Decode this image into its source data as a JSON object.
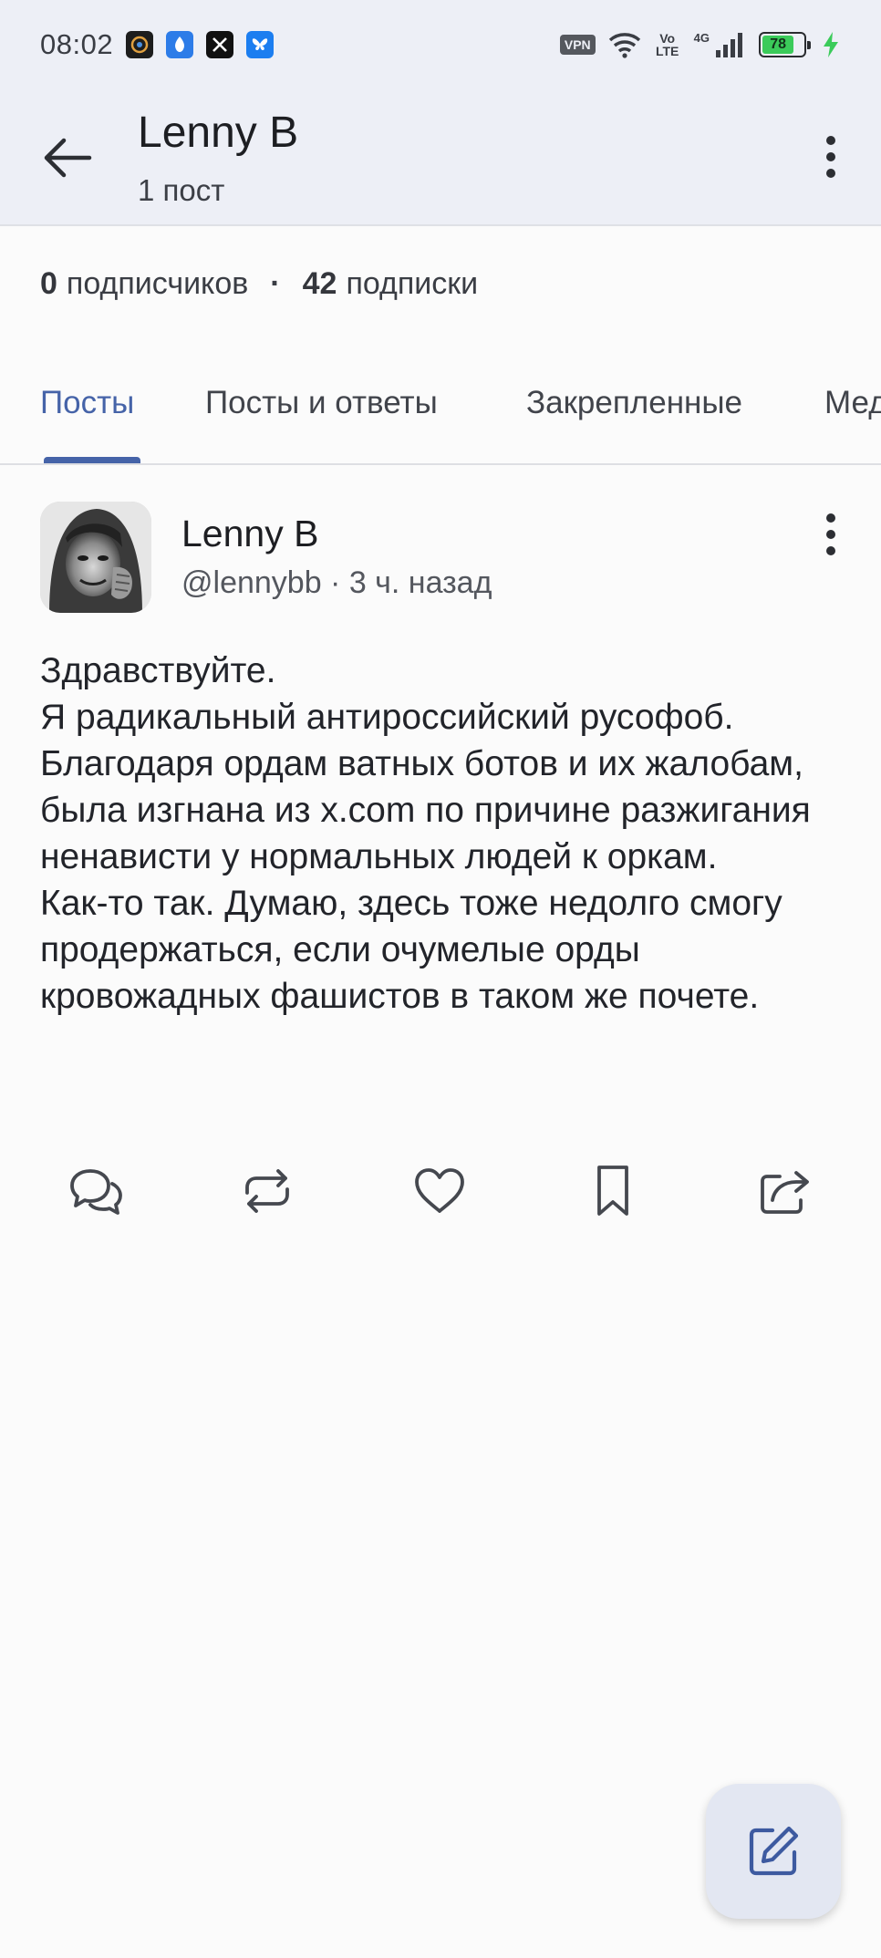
{
  "status_bar": {
    "time": "08:02",
    "app_icons": [
      "app-icon-1",
      "app-icon-2",
      "x-icon",
      "bluesky-icon"
    ],
    "vpn": "VPN",
    "volte": "Vo LTE",
    "network": "4G",
    "battery": "78"
  },
  "header": {
    "title": "Lenny B",
    "subtitle": "1 пост"
  },
  "stats": {
    "followers_count": "0",
    "followers_label": "подписчиков",
    "following_count": "42",
    "following_label": "подписки"
  },
  "tabs": [
    {
      "label": "Посты",
      "active": true
    },
    {
      "label": "Посты и ответы",
      "active": false
    },
    {
      "label": "Закрепленные",
      "active": false
    },
    {
      "label": "Медиа",
      "active": false
    }
  ],
  "post": {
    "author_name": "Lenny B",
    "author_meta": "@lennybb · 3 ч. назад",
    "text": "Здравствуйте.\nЯ радикальный антироссийский русофоб.\nБлагодаря ордам ватных ботов и их жалобам, была изгнана из x.com по причине разжигания ненависти у нормальных людей к оркам.\nКак-то так. Думаю, здесь тоже недолго смогу продержаться, если очумелые орды кровожадных фашистов в таком же почете.",
    "actions": [
      "reply-icon",
      "repost-icon",
      "like-icon",
      "bookmark-icon",
      "share-icon"
    ]
  },
  "colors": {
    "accent": "#4563a8",
    "header_bg": "#edeff6",
    "page_bg": "#fbfbfb"
  }
}
